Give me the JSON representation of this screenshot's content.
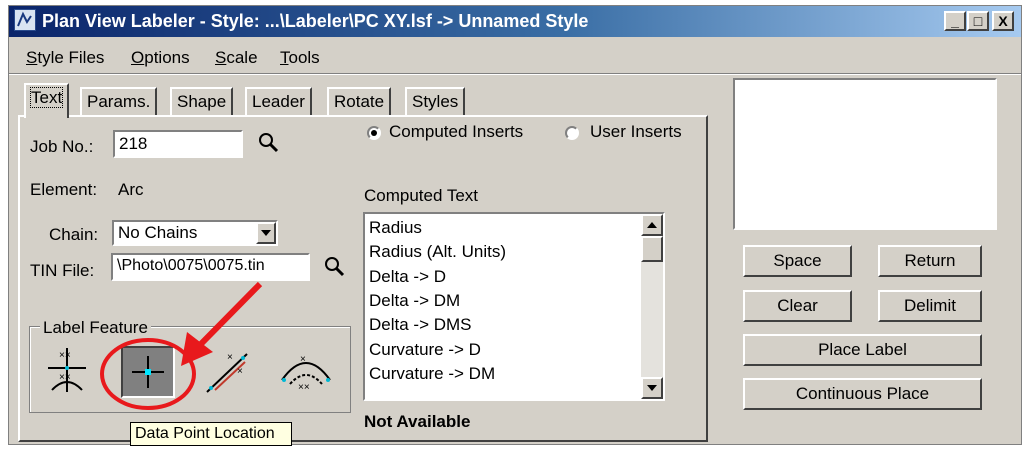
{
  "window": {
    "title": "Plan View Labeler - Style: ...\\Labeler\\PC XY.lsf -> Unnamed Style",
    "minimize_label": "_",
    "maximize_label": "□",
    "close_label": "X"
  },
  "menu": [
    "Style Files",
    "Options",
    "Scale",
    "Tools"
  ],
  "tabs": [
    "Text",
    "Params.",
    "Shape",
    "Leader",
    "Rotate",
    "Styles"
  ],
  "text_tab": {
    "job_label": "Job No.:",
    "job_value": "218",
    "element_label": "Element:",
    "element_value": "Arc",
    "chain_label": "Chain:",
    "chain_value": "No Chains",
    "tin_label": "TIN File:",
    "tin_value": "\\Photo\\0075\\0075.tin",
    "radio_computed": "Computed Inserts",
    "radio_user": "User Inserts",
    "computed_text_label": "Computed Text",
    "computed_items": [
      "Radius",
      "Radius (Alt. Units)",
      "Delta -> D",
      "Delta -> DM",
      "Delta -> DMS",
      "Curvature -> D",
      "Curvature -> DM"
    ],
    "not_available": "Not Available",
    "label_feature": "Label Feature",
    "tooltip": "Data Point Location"
  },
  "buttons": {
    "space": "Space",
    "return": "Return",
    "clear": "Clear",
    "delimit": "Delimit",
    "place_label": "Place Label",
    "continuous_place": "Continuous Place"
  },
  "colors": {
    "title_start": "#0a246a",
    "title_end": "#a6caf0",
    "face": "#d4d0c8",
    "annotation_red": "#e8191c",
    "selected_tool": "#808080",
    "cursor_cyan": "#00e5ff"
  }
}
